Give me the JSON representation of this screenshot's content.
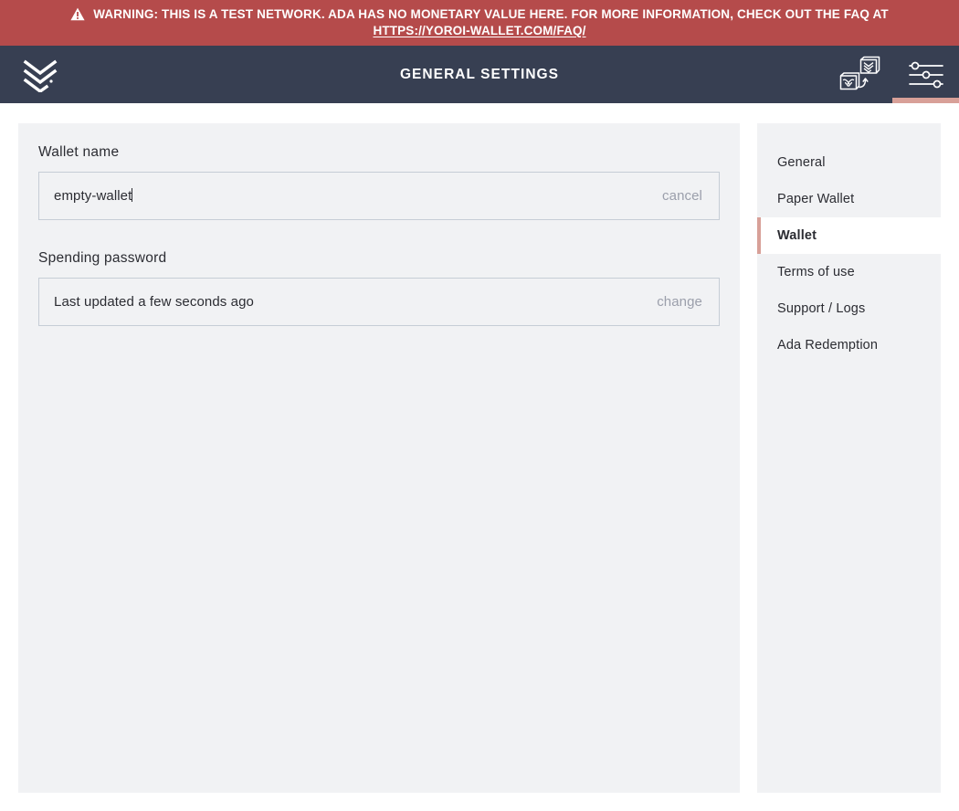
{
  "warning_banner": {
    "icon": "warning-triangle-icon",
    "message": "WARNING: THIS IS A TEST NETWORK. ADA HAS NO MONETARY VALUE HERE. FOR MORE INFORMATION, CHECK OUT THE FAQ AT",
    "url_text": "HTTPS://YOROI-WALLET.COM/FAQ/",
    "background_color": "#b54b4b",
    "text_color": "#ffffff"
  },
  "topbar": {
    "logo": "yoroi-chevron-logo",
    "title": "GENERAL SETTINGS",
    "background_color": "#373f52",
    "active_indicator_color": "#d8a098",
    "actions": [
      {
        "name": "wallet-switch-icon",
        "label": "Switch wallet",
        "active": false
      },
      {
        "name": "settings-sliders-icon",
        "label": "Settings",
        "active": true
      }
    ]
  },
  "settings_pane": {
    "wallet_name": {
      "label": "Wallet name",
      "value": "empty-wallet",
      "placeholder": "Wallet name",
      "action_label": "cancel"
    },
    "spending_password": {
      "label": "Spending password",
      "value": "Last updated a few seconds ago",
      "action_label": "change"
    }
  },
  "settings_menu": {
    "items": [
      {
        "label": "General",
        "active": false
      },
      {
        "label": "Paper Wallet",
        "active": false
      },
      {
        "label": "Wallet",
        "active": true
      },
      {
        "label": "Terms of use",
        "active": false
      },
      {
        "label": "Support / Logs",
        "active": false
      },
      {
        "label": "Ada Redemption",
        "active": false
      }
    ]
  }
}
